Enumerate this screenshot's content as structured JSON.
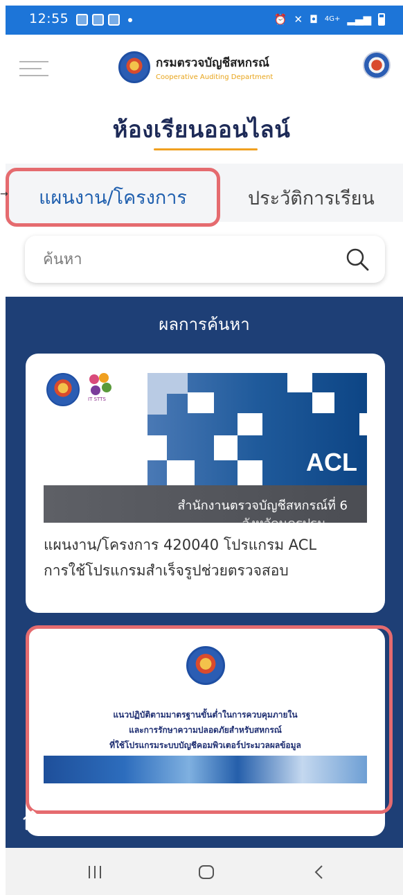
{
  "statusbar": {
    "time": "12:55",
    "network_label": "4G+"
  },
  "header": {
    "org_name_th": "กรมตรวจบัญชีสหกรณ์",
    "org_name_en": "Cooperative Auditing Department"
  },
  "page": {
    "title": "ห้องเรียนออนไลน์"
  },
  "tabs": [
    {
      "label": "แผนงาน/โครงการ",
      "active": true
    },
    {
      "label": "ประวัติการเรียน",
      "active": false
    }
  ],
  "search": {
    "placeholder": "ค้นหา"
  },
  "results": {
    "title": "ผลการค้นหา",
    "items": [
      {
        "banner_label": "ACL",
        "banner_caption": "สำนักงานตรวจบัญชีสหกรณ์ที่ 6",
        "banner_caption2": "จังหวัดนครปฐม",
        "it_logo_caption": "IT STTS",
        "description_line1": "แผนงาน/โครงการ 420040 โปรแกรม ACL",
        "description_line2": "การใช้โปรแกรมสำเร็จรูปช่วยตรวจสอบ"
      },
      {
        "cover_line1": "แนวปฏิบัติตามมาตรฐานขั้นต่ำในการควบคุมภายใน",
        "cover_line2": "และการรักษาความปลอดภัยสำหรับสหกรณ์",
        "cover_line3": "ที่ใช้โปรแกรมระบบบัญชีคอมพิวเตอร์ประมวลผลข้อมูล"
      }
    ]
  },
  "colors": {
    "status_bar": "#1d75d8",
    "results_bg": "#1e3f76",
    "accent_underline": "#f0a020",
    "highlight": "#e56b6f",
    "active_tab_text": "#1f5fae",
    "title_text": "#1d2a57"
  }
}
